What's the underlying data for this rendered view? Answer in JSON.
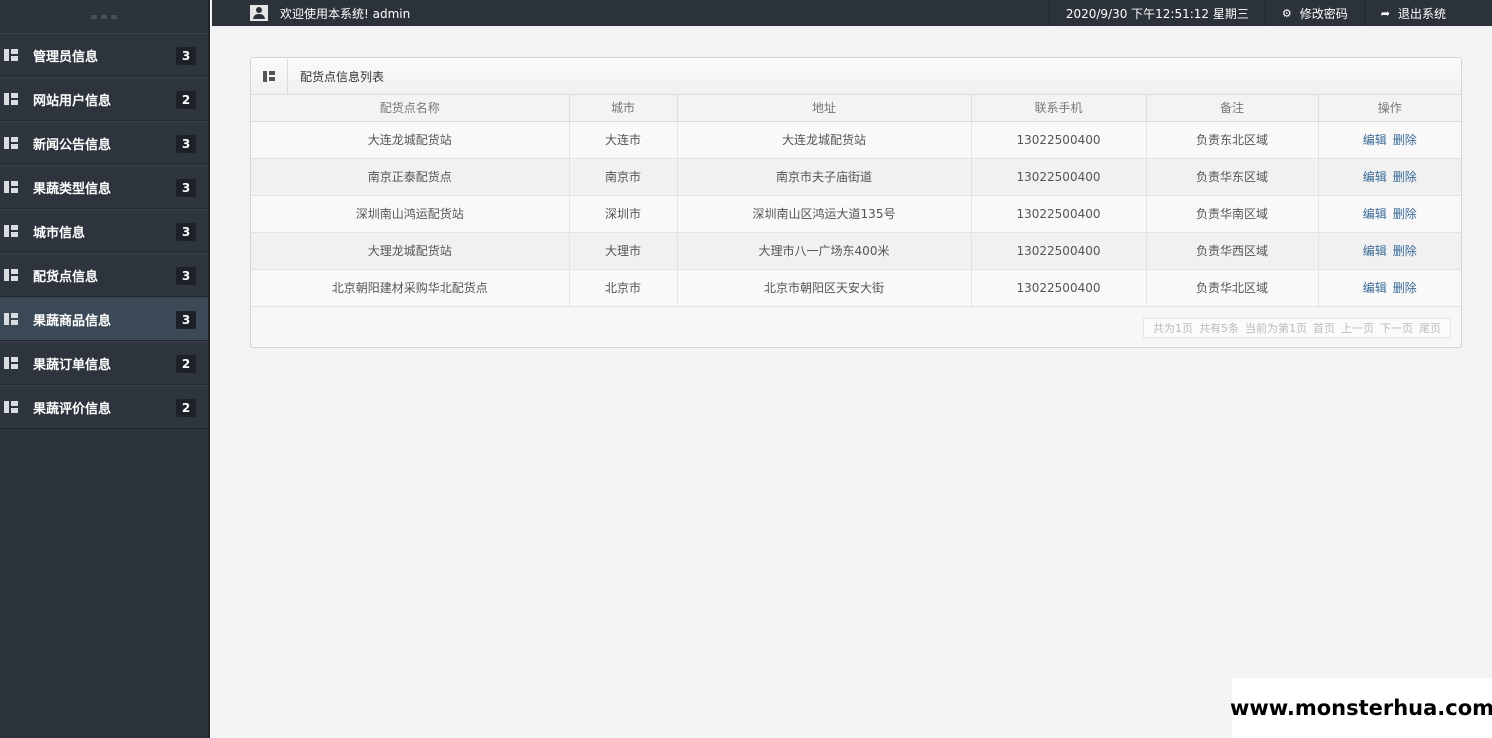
{
  "topbar": {
    "welcome": "欢迎使用本系统! admin",
    "datetime": "2020/9/30 下午12:51:12 星期三",
    "change_password": "修改密码",
    "logout": "退出系统"
  },
  "sidebar": {
    "items": [
      {
        "label": "管理员信息",
        "count": "3"
      },
      {
        "label": "网站用户信息",
        "count": "2"
      },
      {
        "label": "新闻公告信息",
        "count": "3"
      },
      {
        "label": "果蔬类型信息",
        "count": "3"
      },
      {
        "label": "城市信息",
        "count": "3"
      },
      {
        "label": "配货点信息",
        "count": "3"
      },
      {
        "label": "果蔬商品信息",
        "count": "3"
      },
      {
        "label": "果蔬订单信息",
        "count": "2"
      },
      {
        "label": "果蔬评价信息",
        "count": "2"
      }
    ],
    "active_index": 6
  },
  "panel": {
    "title": "配货点信息列表",
    "columns": [
      "配货点名称",
      "城市",
      "地址",
      "联系手机",
      "备注",
      "操作"
    ],
    "rows": [
      [
        "大连龙城配货站",
        "大连市",
        "大连龙城配货站",
        "13022500400",
        "负责东北区域"
      ],
      [
        "南京正泰配货点",
        "南京市",
        "南京市夫子庙街道",
        "13022500400",
        "负责华东区域"
      ],
      [
        "深圳南山鸿运配货站",
        "深圳市",
        "深圳南山区鸿运大道135号",
        "13022500400",
        "负责华南区域"
      ],
      [
        "大理龙城配货站",
        "大理市",
        "大理市八一广场东400米",
        "13022500400",
        "负责华西区域"
      ],
      [
        "北京朝阳建材采购华北配货点",
        "北京市",
        "北京市朝阳区天安大街",
        "13022500400",
        "负责华北区域"
      ]
    ],
    "edit_label": "编辑",
    "delete_label": "删除",
    "pager": {
      "total_pages": "共为1页",
      "total_items": "共有5条",
      "current": "当前为第1页",
      "first": "首页",
      "prev": "上一页",
      "next": "下一页",
      "last": "尾页"
    }
  },
  "watermark": "www.monsterhua.com"
}
